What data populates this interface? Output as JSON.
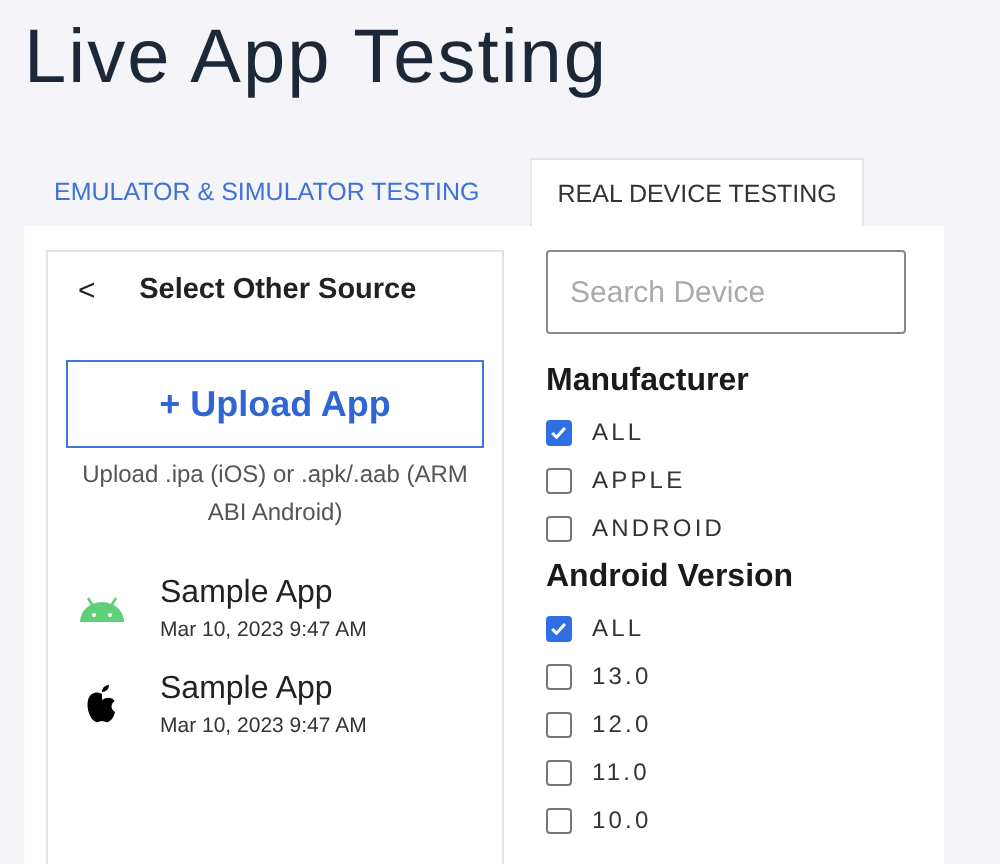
{
  "title": "Live App Testing",
  "tabs": [
    {
      "label": "EMULATOR & SIMULATOR TESTING",
      "selected": false
    },
    {
      "label": "REAL DEVICE TESTING",
      "selected": true
    }
  ],
  "source_panel": {
    "back": "<",
    "title": "Select Other Source",
    "upload_button": "+ Upload App",
    "hint": "Upload .ipa (iOS) or .apk/.aab (ARM ABI Android)",
    "apps": [
      {
        "kind": "android",
        "name": "Sample App",
        "date": "Mar 10, 2023 9:47 AM"
      },
      {
        "kind": "apple",
        "name": "Sample App",
        "date": "Mar 10, 2023 9:47 AM"
      }
    ]
  },
  "filters": {
    "search": {
      "placeholder": "Search Device"
    },
    "groups": [
      {
        "title": "Manufacturer",
        "options": [
          {
            "label": "ALL",
            "checked": true
          },
          {
            "label": "APPLE",
            "checked": false
          },
          {
            "label": "ANDROID",
            "checked": false
          }
        ]
      },
      {
        "title": "Android Version",
        "options": [
          {
            "label": "ALL",
            "checked": true
          },
          {
            "label": "13.0",
            "checked": false
          },
          {
            "label": "12.0",
            "checked": false
          },
          {
            "label": "11.0",
            "checked": false
          },
          {
            "label": "10.0",
            "checked": false
          }
        ]
      }
    ]
  }
}
